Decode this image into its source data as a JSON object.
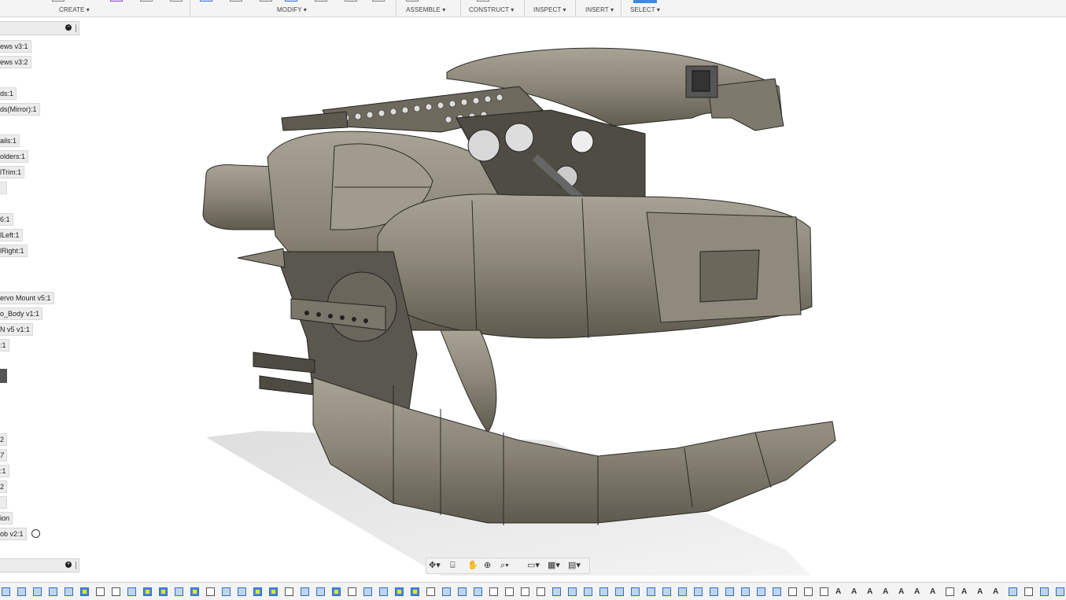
{
  "toolbar": {
    "groups": [
      {
        "label": "CREATE ▾"
      },
      {
        "label": "MODIFY ▾"
      },
      {
        "label": "ASSEMBLE ▾"
      },
      {
        "label": "CONSTRUCT ▾"
      },
      {
        "label": "INSPECT ▾"
      },
      {
        "label": "INSERT ▾"
      },
      {
        "label": "SELECT ▾"
      }
    ]
  },
  "browser": {
    "head_icon": "minus-circle-icon",
    "foot_icon": "plus-circle-icon",
    "items": [
      {
        "label": "ews v3:1"
      },
      {
        "label": "ews v3:2"
      },
      {
        "label": "ds:1"
      },
      {
        "label": "ds(Mirror):1"
      },
      {
        "label": "ails:1"
      },
      {
        "label": "olders:1"
      },
      {
        "label": "lTrim:1"
      },
      {
        "label": ""
      },
      {
        "label": "6:1"
      },
      {
        "label": "lLeft:1"
      },
      {
        "label": "lRight:1"
      },
      {
        "label": "ervo Mount v5:1"
      },
      {
        "label": "o_Body v1:1"
      },
      {
        "label": "N v5 v1:1"
      },
      {
        "label": ":1"
      },
      {
        "label": "2"
      },
      {
        "label": "7"
      },
      {
        "label": ":1"
      },
      {
        "label": "2"
      },
      {
        "label": ""
      },
      {
        "label": "ion"
      },
      {
        "label": "ob v2:1"
      }
    ]
  },
  "nav_bar": {
    "icons": [
      "orbit-icon",
      "look-at-icon",
      "pan-icon",
      "zoom-icon",
      "fit-icon",
      "display-settings-icon",
      "grid-icon",
      "viewports-icon"
    ]
  },
  "timeline": {
    "icon_types": "feature-history"
  },
  "colors": {
    "model": "#8a8576",
    "highlight": "#e8e332",
    "accent": "#3a8ae6"
  }
}
